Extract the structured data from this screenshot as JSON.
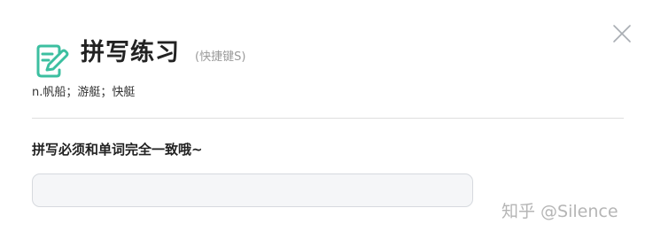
{
  "dialog": {
    "title": "拼写练习",
    "shortcut_hint": "(快捷键S)",
    "word_meaning": "n.帆船；游艇；快艇",
    "instruction": "拼写必须和单词完全一致哦~",
    "answer_input": {
      "value": "",
      "placeholder": ""
    },
    "close_icon": "close-icon",
    "title_icon": "edit-document-icon"
  },
  "watermark": "知乎 @Silence",
  "colors": {
    "accent": "#3cbfa0",
    "divider": "#dedede",
    "input_bg": "#f5f6f8",
    "input_border": "#d6d9de"
  }
}
